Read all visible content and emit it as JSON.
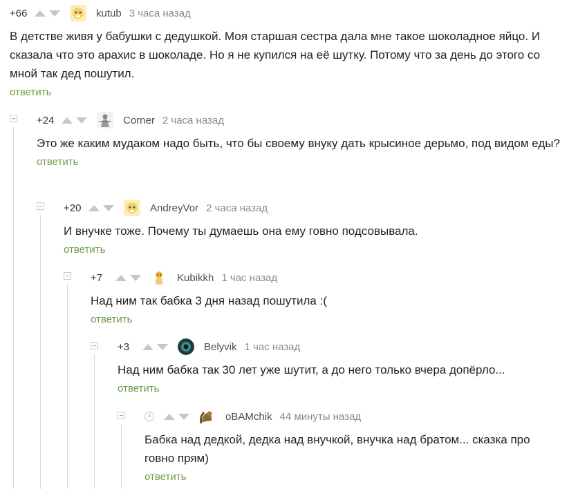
{
  "comments": [
    {
      "rating": "+66",
      "author": "kutub",
      "time": "3 часа назад",
      "text": "В детстве живя у бабушки с дедушкой. Моя старшая сестра дала мне такое шоколадное яйцо. И сказала что это арахис в шоколаде. Но я не купился на её шутку. Потому что за день до этого со мной так дед пошутил.",
      "reply": "ответить",
      "avatar": "ghost-avatar"
    },
    {
      "rating": "+24",
      "author": "Corner",
      "time": "2 часа назад",
      "text": "Это же каким мудаком надо быть, что бы своему внуку дать крысиное дерьмо, под видом еды?",
      "reply": "ответить",
      "avatar": "figure-avatar"
    },
    {
      "rating": "+20",
      "author": "AndreyVor",
      "time": "2 часа назад",
      "text": "И внучке тоже. Почему ты думаешь она ему говно подсовывала.",
      "reply": "ответить",
      "avatar": "ghost-avatar"
    },
    {
      "rating": "+7",
      "author": "Kubikkh",
      "time": "1 час назад",
      "text": "Над ним так бабка 3 дня назад пошутила :(",
      "reply": "ответить",
      "avatar": "character-avatar"
    },
    {
      "rating": "+3",
      "author": "Belyvik",
      "time": "1 час назад",
      "text": "Над ним бабка так 30 лет уже шутит, а до него только вчера допёрло...",
      "reply": "ответить",
      "avatar": "dark-round-avatar"
    },
    {
      "rating": "",
      "author": "oBAMchik",
      "time": "44 минуты назад",
      "text": "Бабка над дедкой, дедка над внучкой, внучка над братом... сказка про говно прям)",
      "reply": "ответить",
      "avatar": "squirrel-avatar"
    }
  ]
}
